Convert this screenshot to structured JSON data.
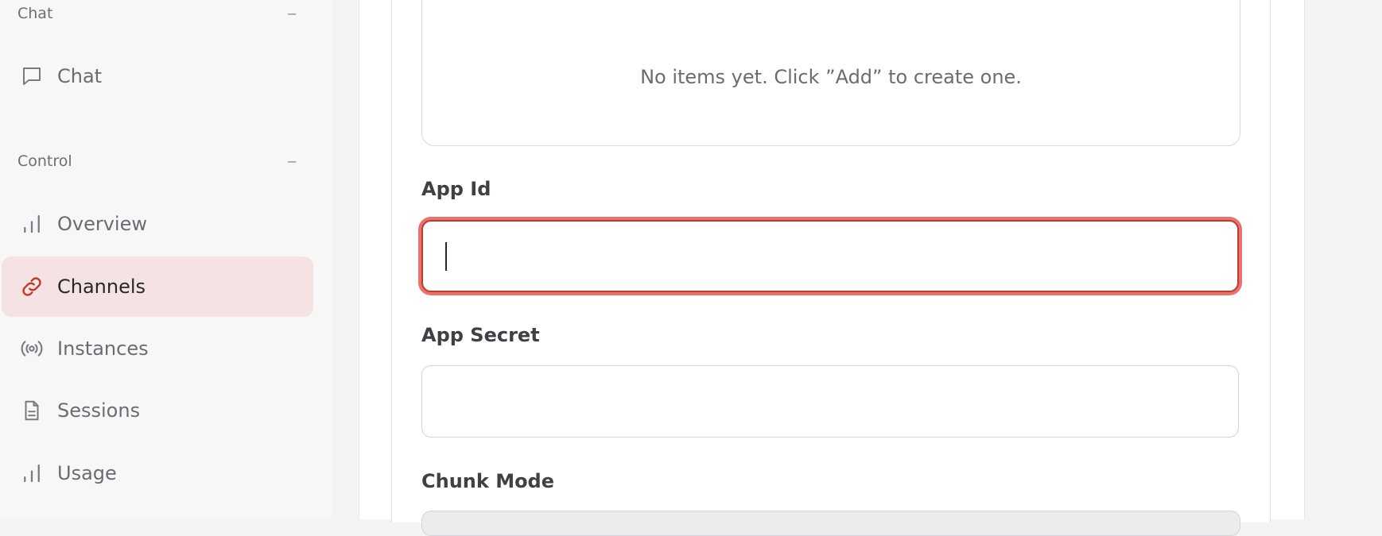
{
  "sidebar": {
    "sections": [
      {
        "title": "Chat",
        "collapse_symbol": "−"
      },
      {
        "title": "Control",
        "collapse_symbol": "−"
      }
    ],
    "items": [
      {
        "label": "Chat",
        "icon": "message-square-icon"
      },
      {
        "label": "Overview",
        "icon": "bar-chart-icon"
      },
      {
        "label": "Channels",
        "icon": "link-icon",
        "active": true
      },
      {
        "label": "Instances",
        "icon": "radio-broadcast-icon"
      },
      {
        "label": "Sessions",
        "icon": "file-text-icon"
      },
      {
        "label": "Usage",
        "icon": "bar-chart-icon"
      }
    ]
  },
  "main": {
    "empty_state": "No items yet. Click ”Add” to create one.",
    "fields": {
      "app_id": {
        "label": "App Id",
        "value": ""
      },
      "app_secret": {
        "label": "App Secret",
        "value": ""
      },
      "chunk_mode": {
        "label": "Chunk Mode"
      }
    }
  },
  "colors": {
    "accent": "#c0392b",
    "active_bg": "#f5e3e3",
    "focus_ring": "#e8726c"
  }
}
